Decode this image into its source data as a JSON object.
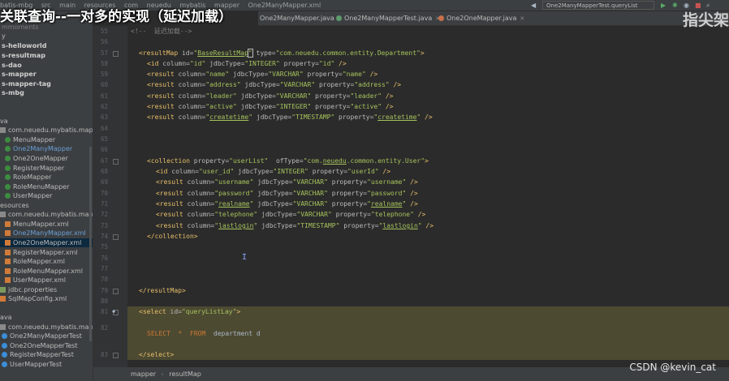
{
  "overlay": {
    "title": "关联查询--一对多的实现（延迟加载）",
    "watermark": "指尖架",
    "credit": "CSDN @kevin_cat"
  },
  "topbar": {
    "crumbs": [
      "batis-mbg",
      "src",
      "main",
      "resources",
      "com",
      "neuedu",
      "mybatis",
      "mapper",
      "One2ManyMapper.xml"
    ],
    "run_config": "One2ManyMapperTest.queryList"
  },
  "tabs": [
    {
      "label": "One2ManyMapper.java"
    },
    {
      "label": "One2ManyMapperTest.java"
    },
    {
      "label": "One2OneMapper.java"
    }
  ],
  "sidebar": {
    "items": [
      {
        "label": "mmoments"
      },
      {
        "label": "y"
      },
      {
        "label": "s-helloworld"
      },
      {
        "label": "s-resultmap"
      },
      {
        "label": "s-dao"
      },
      {
        "label": "s-mapper"
      },
      {
        "label": "s-mapper-tag"
      },
      {
        "label": "s-mbg"
      },
      {
        "label": "va"
      },
      {
        "label": "com.neuedu.mybatis.mapper"
      },
      {
        "label": "MenuMapper"
      },
      {
        "label": "One2ManyMapper"
      },
      {
        "label": "One2OneMapper"
      },
      {
        "label": "RegisterMapper"
      },
      {
        "label": "RoleMapper"
      },
      {
        "label": "RoleMenuMapper"
      },
      {
        "label": "UserMapper"
      },
      {
        "label": "esources"
      },
      {
        "label": "com.neuedu.mybatis.mapper"
      },
      {
        "label": "MenuMapper.xml"
      },
      {
        "label": "One2ManyMapper.xml"
      },
      {
        "label": "One2OneMapper.xml"
      },
      {
        "label": "RegisterMapper.xml"
      },
      {
        "label": "RoleMapper.xml"
      },
      {
        "label": "RoleMenuMapper.xml"
      },
      {
        "label": "UserMapper.xml"
      },
      {
        "label": "jdbc.properties"
      },
      {
        "label": "SqlMapConfig.xml"
      },
      {
        "label": "ava"
      },
      {
        "label": "com.neuedu.mybatis.mapper"
      },
      {
        "label": "One2ManyMapperTest"
      },
      {
        "label": "One2OneMapperTest"
      },
      {
        "label": "RegisterMapperTest"
      },
      {
        "label": "UserMapperTest"
      }
    ]
  },
  "editor": {
    "line_numbers": [
      "55",
      "56",
      "57",
      "58",
      "59",
      "60",
      "61",
      "62",
      "63",
      "64",
      "65",
      "66",
      "67",
      "68",
      "69",
      "70",
      "71",
      "72",
      "73",
      "74",
      "75",
      "76",
      "77",
      "78",
      "79",
      "80",
      "81",
      "82",
      "83"
    ],
    "lines": {
      "l55_comment": "<!--  延迟加载-->",
      "l57": {
        "open": "<resultMap ",
        "a_id": "id=",
        "v_id_q1": "\"",
        "v_id_b": "BaseResultMap",
        "v_id_q2": "\"",
        "a_type": " type=",
        "v_type": "\"com.neuedu.common.entity.Department\"",
        "close": ">"
      },
      "l58": {
        "open": "<id ",
        "a1": "column=",
        "v1": "\"id\"",
        "a2": " jdbcType=",
        "v2": "\"INTEGER\"",
        "a3": " property=",
        "v3": "\"id\"",
        "close": " />"
      },
      "l59": {
        "open": "<result ",
        "a1": "column=",
        "v1": "\"name\"",
        "a2": " jdbcType=",
        "v2": "\"VARCHAR\"",
        "a3": " property=",
        "v3": "\"name\"",
        "close": " />"
      },
      "l60": {
        "open": "<result ",
        "a1": "column=",
        "v1": "\"address\"",
        "a2": " jdbcType=",
        "v2": "\"VARCHAR\"",
        "a3": " property=",
        "v3": "\"address\"",
        "close": " />"
      },
      "l61": {
        "open": "<result ",
        "a1": "column=",
        "v1": "\"leader\"",
        "a2": " jdbcType=",
        "v2": "\"VARCHAR\"",
        "a3": " property=",
        "v3": "\"leader\"",
        "close": " />"
      },
      "l62": {
        "open": "<result ",
        "a1": "column=",
        "v1": "\"active\"",
        "a2": " jdbcType=",
        "v2": "\"INTEGER\"",
        "a3": " property=",
        "v3": "\"active\"",
        "close": " />"
      },
      "l63": {
        "open": "<result ",
        "a1": "column=",
        "v1q": "\"",
        "v1u": "createtime",
        "v1q2": "\"",
        "a2": " jdbcType=",
        "v2": "\"TIMESTAMP\"",
        "a3": " property=",
        "v3q": "\"",
        "v3u": "createtime",
        "v3q2": "\"",
        "close": " />"
      },
      "l67": {
        "open": "<collection ",
        "a1": "property=",
        "v1": "\"userList\"",
        "a2": "  ofType=",
        "v2a": "\"com.",
        "v2u": "neuedu",
        "v2b": ".common.entity.User\"",
        "close": ">"
      },
      "l68": {
        "open": "<id ",
        "a1": "column=",
        "v1": "\"user_id\"",
        "a2": " jdbcType=",
        "v2": "\"INTEGER\"",
        "a3": " property=",
        "v3": "\"userId\"",
        "close": " />"
      },
      "l69": {
        "open": "<result ",
        "a1": "column=",
        "v1": "\"username\"",
        "a2": " jdbcType=",
        "v2": "\"VARCHAR\"",
        "a3": " property=",
        "v3": "\"username\"",
        "close": " />"
      },
      "l70": {
        "open": "<result ",
        "a1": "column=",
        "v1": "\"password\"",
        "a2": " jdbcType=",
        "v2": "\"VARCHAR\"",
        "a3": " property=",
        "v3": "\"password\"",
        "close": " />"
      },
      "l71": {
        "open": "<result ",
        "a1": "column=",
        "v1q": "\"",
        "v1u": "realname",
        "v1q2": "\"",
        "a2": " jdbcType=",
        "v2": "\"VARCHAR\"",
        "a3": " property=",
        "v3q": "\"",
        "v3u": "realname",
        "v3q2": "\"",
        "close": " />"
      },
      "l72": {
        "open": "<result ",
        "a1": "column=",
        "v1": "\"telephone\"",
        "a2": " jdbcType=",
        "v2": "\"VARCHAR\"",
        "a3": " property=",
        "v3": "\"telephone\"",
        "close": " />"
      },
      "l73": {
        "open": "<result ",
        "a1": "column=",
        "v1q": "\"",
        "v1u": "lastlogin",
        "v1q2": "\"",
        "a2": " jdbcType=",
        "v2": "\"TIMESTAMP\"",
        "a3": " property=",
        "v3q": "\"",
        "v3u": "lastlogin",
        "v3q2": "\"",
        "close": " />"
      },
      "l74": "</collection>",
      "l78": "</resultMap>",
      "l80": {
        "open": "<select ",
        "a1": "id=",
        "v1": "\"queryListLay\"",
        "close": ">"
      },
      "l81": {
        "k1": "SELECT",
        "star": "*",
        "k2": "FROM",
        "rest": "department d"
      },
      "l82": "</select>"
    }
  },
  "breadcrumb": {
    "items": [
      "mapper",
      "resultMap"
    ]
  },
  "colors": {
    "tag": "#e8bf6a",
    "attr": "#bababa",
    "value": "#a5c25c",
    "comment": "#808080",
    "keyword": "#cc7832",
    "editor_bg": "#2b2b2b",
    "highlight": "#4d4a32"
  }
}
